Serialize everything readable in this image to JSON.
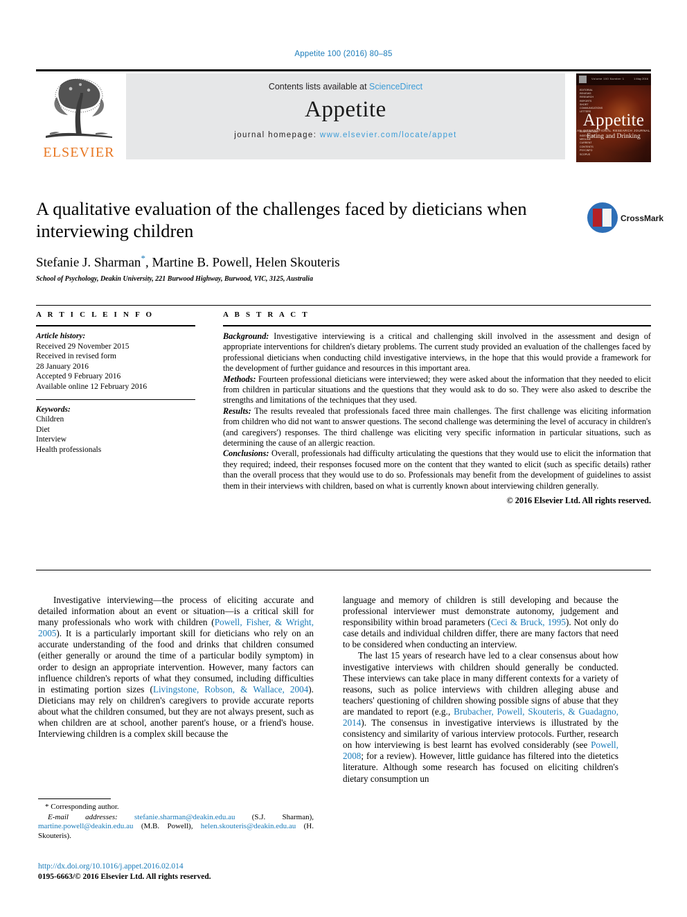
{
  "running_head": "Appetite 100 (2016) 80–85",
  "masthead": {
    "publisher_name": "ELSEVIER",
    "contents_prefix": "Contents lists available at ",
    "contents_link": "ScienceDirect",
    "journal_name": "Appetite",
    "homepage_prefix": "journal homepage: ",
    "homepage_url": "www.elsevier.com/locate/appet",
    "cover": {
      "title": "Appetite",
      "subtitle_small": "AN INTERNATIONAL RESEARCH JOURNAL",
      "subtitle": "Eating and Drinking",
      "volume_label": "Volume 100   Number 1",
      "date_label": "1 May 2016",
      "side_list": "EDITORIAL\nREVIEWS\nRESEARCH\nREPORTS\nSHORT\nCOMMUNICATIONS\nLETTERS",
      "bottom_list": "ISSN 0195-6663\nINDEXED IN\nMEDLINE\nCURRENT CONTENTS\nPSYCINFO\nSCOPUS"
    }
  },
  "article": {
    "title": "A qualitative evaluation of the challenges faced by dieticians when interviewing children",
    "authors": "Stefanie J. Sharman",
    "authors_rest": ", Martine B. Powell, Helen Skouteris",
    "corresponding_marker": "*",
    "affiliation": "School of Psychology, Deakin University, 221 Burwood Highway, Burwood, VIC, 3125, Australia",
    "crossmark_label": "CrossMark"
  },
  "article_info": {
    "heading": "A R T I C L E   I N F O",
    "history_label": "Article history:",
    "history": [
      "Received 29 November 2015",
      "Received in revised form",
      "28 January 2016",
      "Accepted 9 February 2016",
      "Available online 12 February 2016"
    ],
    "keywords_label": "Keywords:",
    "keywords": [
      "Children",
      "Diet",
      "Interview",
      "Health professionals"
    ]
  },
  "abstract": {
    "heading": "A B S T R A C T",
    "background_label": "Background:",
    "background_text": " Investigative interviewing is a critical and challenging skill involved in the assessment and design of appropriate interventions for children's dietary problems. The current study provided an evaluation of the challenges faced by professional dieticians when conducting child investigative interviews, in the hope that this would provide a framework for the development of further guidance and resources in this important area.",
    "methods_label": "Methods:",
    "methods_text": " Fourteen professional dieticians were interviewed; they were asked about the information that they needed to elicit from children in particular situations and the questions that they would ask to do so. They were also asked to describe the strengths and limitations of the techniques that they used.",
    "results_label": "Results:",
    "results_text": " The results revealed that professionals faced three main challenges. The first challenge was eliciting information from children who did not want to answer questions. The second challenge was determining the level of accuracy in children's (and caregivers') responses. The third challenge was eliciting very specific information in particular situations, such as determining the cause of an allergic reaction.",
    "conclusions_label": "Conclusions:",
    "conclusions_text": " Overall, professionals had difficulty articulating the questions that they would use to elicit the information that they required; indeed, their responses focused more on the content that they wanted to elicit (such as specific details) rather than the overall process that they would use to do so. Professionals may benefit from the development of guidelines to assist them in their interviews with children, based on what is currently known about interviewing children generally.",
    "copyright": "© 2016 Elsevier Ltd. All rights reserved."
  },
  "body": {
    "left_p1_a": "Investigative interviewing—the process of eliciting accurate and detailed information about an event or situation—is a critical skill for many professionals who work with children (",
    "left_cite1": "Powell, Fisher, & Wright, 2005",
    "left_p1_b": "). It is a particularly important skill for dieticians who rely on an accurate understanding of the food and drinks that children consumed (either generally or around the time of a particular bodily symptom) in order to design an appropriate intervention. However, many factors can influence children's reports of what they consumed, including difficulties in estimating portion sizes (",
    "left_cite2": "Livingstone, Robson, & Wallace, 2004",
    "left_p1_c": "). Dieticians may rely on children's caregivers to provide accurate reports about what the children consumed, but they are not always present, such as when children are at school, another parent's house, or a friend's house. Interviewing children is a complex skill because the",
    "right_p1_a": "language and memory of children is still developing and because the professional interviewer must demonstrate autonomy, judgement and responsibility within broad parameters (",
    "right_cite1": "Ceci & Bruck, 1995",
    "right_p1_b": "). Not only do case details and individual children differ, there are many factors that need to be considered when conducting an interview.",
    "right_p2_a": "The last 15 years of research have led to a clear consensus about how investigative interviews with children should generally be conducted. These interviews can take place in many different contexts for a variety of reasons, such as police interviews with children alleging abuse and teachers' questioning of children showing possible signs of abuse that they are mandated to report (e.g., ",
    "right_cite2": "Brubacher, Powell, Skouteris, & Guadagno, 2014",
    "right_p2_b": "). The consensus in investigative interviews is illustrated by the consistency and similarity of various interview protocols. Further, research on how interviewing is best learnt has evolved considerably (see ",
    "right_cite3": "Powell, 2008",
    "right_p2_c": "; for a review). However, little guidance has filtered into the dietetics literature. Although some research has focused on eliciting children's dietary consumption un"
  },
  "footnotes": {
    "corresponding": "* Corresponding author.",
    "email_label": "E-mail addresses:",
    "email1": "stefanie.sharman@deakin.edu.au",
    "email1_owner": " (S.J. Sharman), ",
    "email2": "martine.powell@deakin.edu.au",
    "email2_owner": " (M.B. Powell), ",
    "email3": "helen.skouteris@deakin.edu.au",
    "email3_owner": " (H. Skouteris).",
    "doi": "http://dx.doi.org/10.1016/j.appet.2016.02.014",
    "issn": "0195-6663/© 2016 Elsevier Ltd. All rights reserved."
  },
  "colors": {
    "link_blue": "#1a7bb9",
    "sciencedirect_blue": "#3c9cd7",
    "elsevier_orange": "#e87722",
    "crossmark_blue": "#2e6fb7",
    "crossmark_red": "#b52025",
    "band_gray": "#e6e7e8"
  }
}
